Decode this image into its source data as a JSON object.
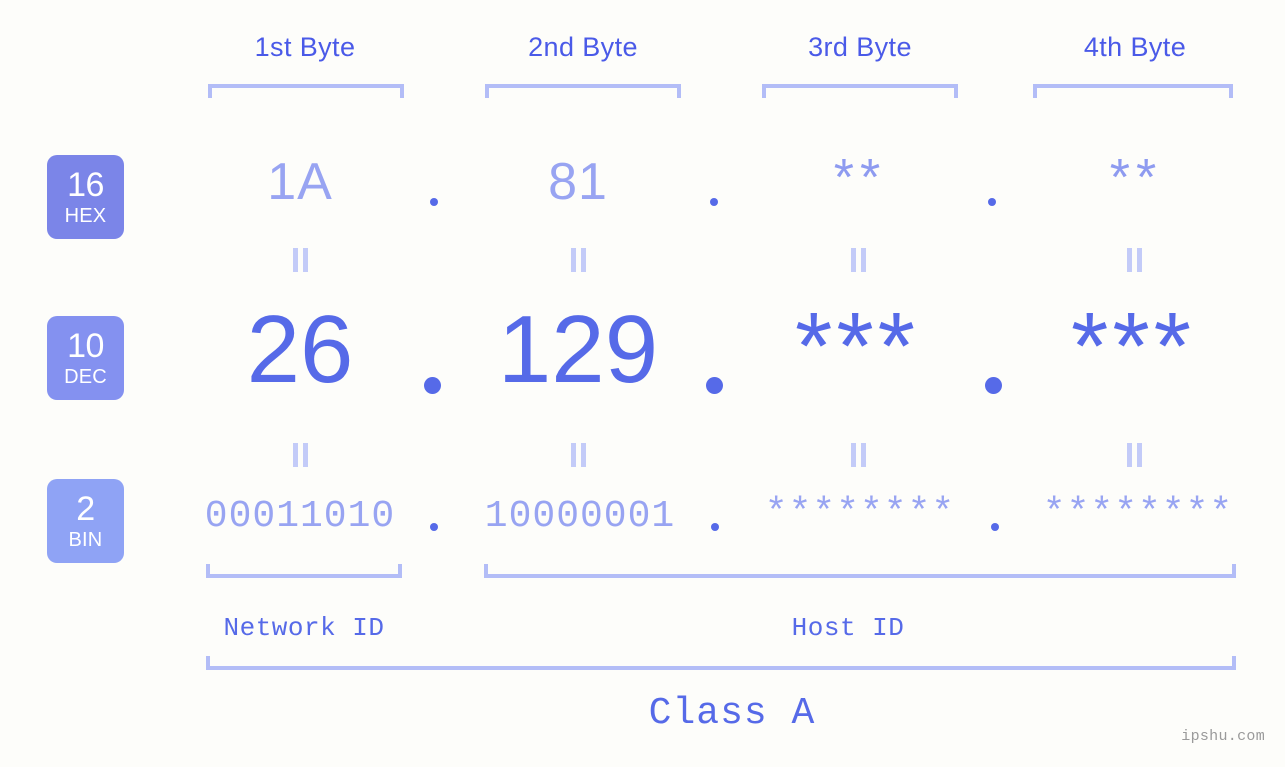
{
  "background_color": "#fdfdfa",
  "accent_colors": {
    "label_blue": "#4a5ae8",
    "value_blue": "#566ae8",
    "muted_blue": "#98a4f2",
    "bracket_blue": "#b3bdf7",
    "badge_hex": "#7b85e8",
    "badge_dec": "#8491f0",
    "badge_bin": "#8fa3f5",
    "watermark_gray": "#9a9a9a"
  },
  "byte_headers": [
    {
      "label": "1st Byte"
    },
    {
      "label": "2nd Byte"
    },
    {
      "label": "3rd Byte"
    },
    {
      "label": "4th Byte"
    }
  ],
  "bases": [
    {
      "number": "16",
      "name": "HEX"
    },
    {
      "number": "10",
      "name": "DEC"
    },
    {
      "number": "2",
      "name": "BIN"
    }
  ],
  "rows": {
    "hex": {
      "base_number": "16",
      "base_name": "HEX",
      "values": [
        "1A",
        "81",
        "**",
        "**"
      ]
    },
    "dec": {
      "base_number": "10",
      "base_name": "DEC",
      "values": [
        "26",
        "129",
        "***",
        "***"
      ]
    },
    "bin": {
      "base_number": "2",
      "base_name": "BIN",
      "values": [
        "00011010",
        "10000001",
        "********",
        "********"
      ]
    }
  },
  "separators": {
    "dot": ".",
    "equals_mark": "||"
  },
  "segments": {
    "network_id": "Network ID",
    "host_id": "Host ID",
    "class": "Class A"
  },
  "watermark": "ipshu.com"
}
